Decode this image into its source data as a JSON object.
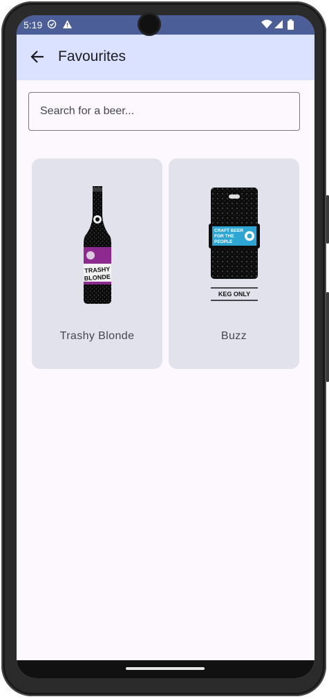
{
  "status_bar": {
    "time": "5:19",
    "icons": [
      "sync-check-icon",
      "warning-icon",
      "wifi-icon",
      "cellular-icon",
      "battery-icon"
    ]
  },
  "app_bar": {
    "title": "Favourites",
    "back_icon": "arrow-back-icon"
  },
  "search": {
    "placeholder": "Search for a beer...",
    "value": ""
  },
  "beers": [
    {
      "name": "Trashy Blonde",
      "image": "trashy-blonde-bottle",
      "label_text": "TRASHY BLONDE"
    },
    {
      "name": "Buzz",
      "image": "buzz-keg",
      "label_text": "CRAFT BEER FOR THE PEOPLE",
      "caption": "KEG ONLY"
    }
  ],
  "colors": {
    "status_bar": "#4c5e98",
    "app_bar": "#dbe2ff",
    "card": "#e2e2ec",
    "bottle_label": "#8e2a8f",
    "keg_label": "#2ea6d4"
  }
}
